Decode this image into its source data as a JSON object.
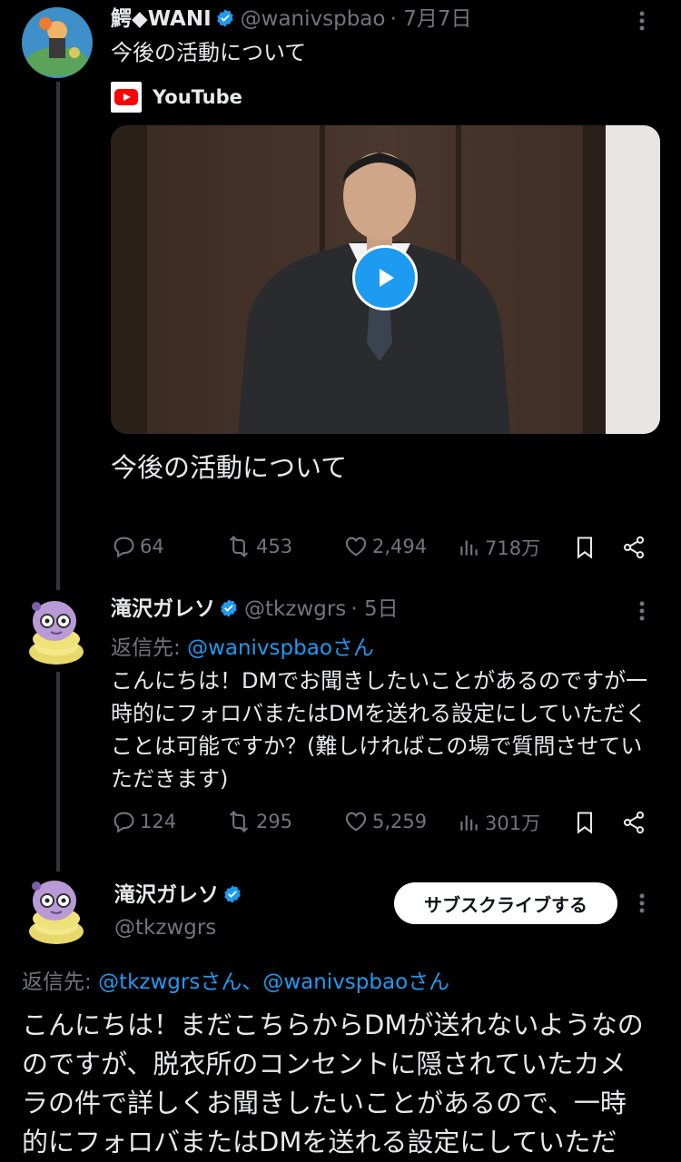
{
  "tweet1": {
    "name": "鰐◆WANI",
    "handle": "@wanivspbao",
    "date": "· 7月7日",
    "text": "今後の活動について",
    "card_source": "YouTube",
    "video_title": "今後の活動について",
    "stats": {
      "replies": "64",
      "retweets": "453",
      "likes": "2,494",
      "views": "718万"
    }
  },
  "tweet2": {
    "name": "滝沢ガレソ",
    "handle": "@tkzwgrs",
    "date": "· 5日",
    "reply_label": "返信先:",
    "reply_to": "@wanivspbaoさん",
    "lines": [
      "こんにちは！DMでお聞きしたいことがあるのですが一",
      "時的にフォロバまたはDMを送れる設定にしていただく",
      "ことは可能ですか？(難しければこの場で質問させてい",
      "ただきます)"
    ],
    "stats": {
      "replies": "124",
      "retweets": "295",
      "likes": "5,259",
      "views": "301万"
    }
  },
  "tweet3": {
    "name": "滝沢ガレソ",
    "handle": "@tkzwgrs",
    "subscribe_label": "サブスクライブする",
    "reply_label": "返信先:",
    "reply_to": "@tkzwgrsさん、@wanivspbaoさん",
    "lines": [
      "こんにちは！まだこちらからDMが送れないようなの",
      "のですが、脱衣所のコンセントに隠されていたカメ",
      "ラの件で詳しくお聞きしたいことがあるので、一時",
      "的にフォロバまたはDMを送れる設定にしていただ"
    ]
  },
  "icons": {
    "verified": "verified-badge-icon",
    "more": "more-icon",
    "reply": "reply-icon",
    "retweet": "retweet-icon",
    "like": "like-icon",
    "views": "views-icon",
    "bookmark": "bookmark-icon",
    "share": "share-icon",
    "play": "play-icon",
    "youtube": "youtube-logo-icon"
  },
  "colors": {
    "accent": "#1d9bf0",
    "background": "#000000",
    "text": "#e7e9ea",
    "muted": "#71767b"
  }
}
